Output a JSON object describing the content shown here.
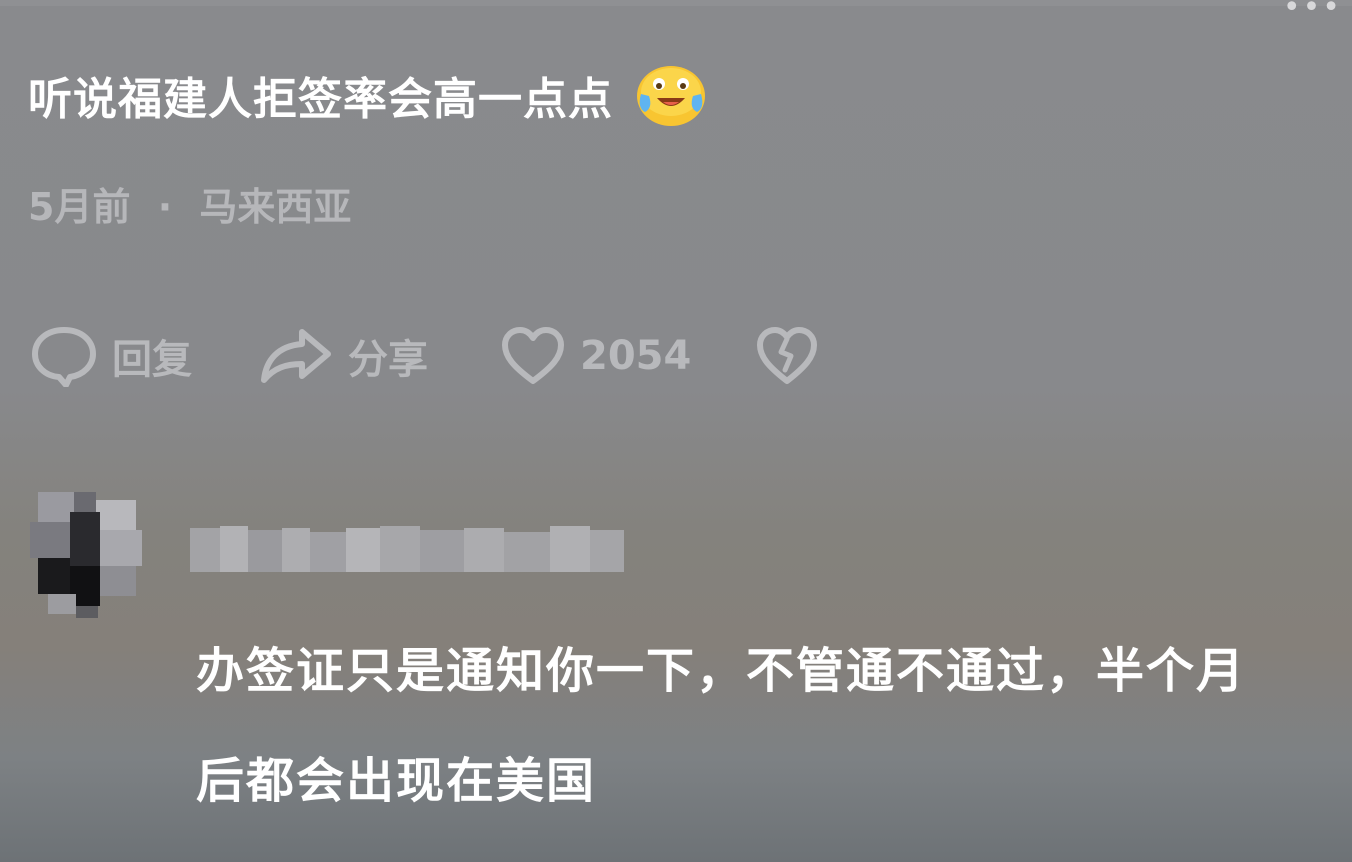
{
  "comment": {
    "text": "听说福建人拒签率会高一点点",
    "emoji": "laughing-crying-emoji",
    "time": "5月前",
    "separator": "·",
    "location": "马来西亚"
  },
  "actions": {
    "reply_label": "回复",
    "share_label": "分享",
    "like_count": "2054"
  },
  "reply": {
    "text": "办签证只是通知你一下，不管通不通过，半个月后都会出现在美国"
  },
  "colors": {
    "background": "#898a8d",
    "text_primary": "#ffffff",
    "text_secondary": "#b6b7ba"
  }
}
